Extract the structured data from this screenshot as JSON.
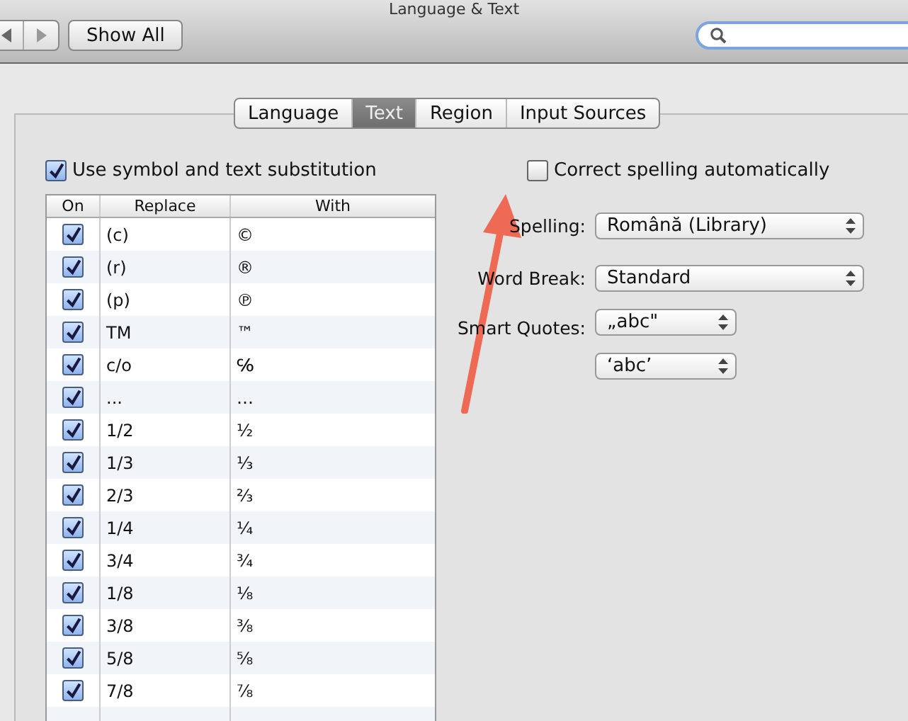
{
  "window": {
    "title": "Language & Text"
  },
  "toolbar": {
    "show_all": "Show All"
  },
  "tabs": [
    {
      "label": "Language",
      "selected": false
    },
    {
      "label": "Text",
      "selected": true
    },
    {
      "label": "Region",
      "selected": false
    },
    {
      "label": "Input Sources",
      "selected": false
    }
  ],
  "substitution": {
    "label": "Use symbol and text substitution",
    "checked": true
  },
  "table": {
    "columns": [
      "On",
      "Replace",
      "With"
    ],
    "rows": [
      {
        "on": true,
        "replace": "(c)",
        "with": "©"
      },
      {
        "on": true,
        "replace": "(r)",
        "with": "®"
      },
      {
        "on": true,
        "replace": "(p)",
        "with": "℗"
      },
      {
        "on": true,
        "replace": "TM",
        "with": "™"
      },
      {
        "on": true,
        "replace": "c/o",
        "with": "℅"
      },
      {
        "on": true,
        "replace": "...",
        "with": "…"
      },
      {
        "on": true,
        "replace": "1/2",
        "with": "½"
      },
      {
        "on": true,
        "replace": "1/3",
        "with": "⅓"
      },
      {
        "on": true,
        "replace": "2/3",
        "with": "⅔"
      },
      {
        "on": true,
        "replace": "1/4",
        "with": "¼"
      },
      {
        "on": true,
        "replace": "3/4",
        "with": "¾"
      },
      {
        "on": true,
        "replace": "1/8",
        "with": "⅛"
      },
      {
        "on": true,
        "replace": "3/8",
        "with": "⅜"
      },
      {
        "on": true,
        "replace": "5/8",
        "with": "⅝"
      },
      {
        "on": true,
        "replace": "7/8",
        "with": "⅞"
      }
    ]
  },
  "correct_spelling": {
    "label": "Correct spelling automatically",
    "checked": false
  },
  "spelling": {
    "label": "Spelling:",
    "value": "Română (Library)"
  },
  "word_break": {
    "label": "Word Break:",
    "value": "Standard"
  },
  "smart_quotes": {
    "label": "Smart Quotes:",
    "double": "„abc\"",
    "single": "‘abc’"
  }
}
